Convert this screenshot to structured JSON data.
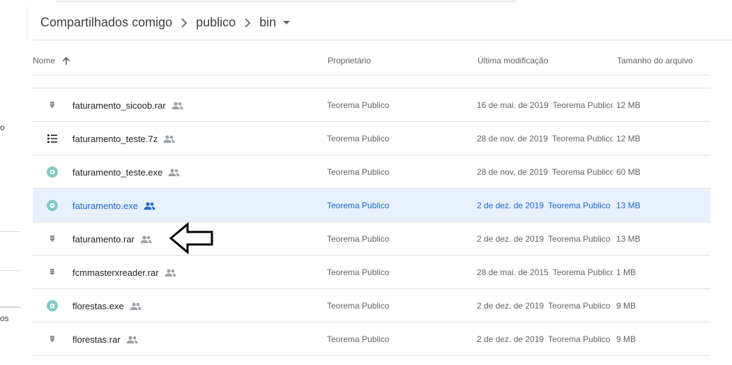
{
  "sidebar": {
    "frag_1": "o",
    "frag_2": "os"
  },
  "breadcrumb": {
    "items": [
      "Compartilhados comigo",
      "publico",
      "bin"
    ]
  },
  "toolbar": {
    "icons": [
      "link-icon",
      "add-person-icon",
      "preview-eye-icon",
      "trash-icon",
      "more-vert-icon",
      "grid-view-icon"
    ]
  },
  "columns": {
    "name": "Nome",
    "owner": "Proprietário",
    "modified": "Última modificação",
    "size": "Tamanho do arquivo"
  },
  "files": [
    {
      "name": "faturamento_sicoob.rar",
      "icon": "archive-icon",
      "owner": "Teorema Publico",
      "date": "16 de mai. de 2019",
      "by": "Teorema Publico",
      "size": "12 MB",
      "selected": false
    },
    {
      "name": "faturamento_teste.7z",
      "icon": "list-file-icon",
      "owner": "Teorema Publico",
      "date": "28 de nov. de 2019",
      "by": "Teorema Publico",
      "size": "12 MB",
      "selected": false
    },
    {
      "name": "faturamento_teste.exe",
      "icon": "exe-file-icon",
      "owner": "Teorema Publico",
      "date": "28 de nov. de 2019",
      "by": "Teorema Publico",
      "size": "60 MB",
      "selected": false
    },
    {
      "name": "faturamento.exe",
      "icon": "exe-file-icon",
      "owner": "Teorema Publico",
      "date": "2 de dez. de 2019",
      "by": "Teorema Publico",
      "size": "13 MB",
      "selected": true
    },
    {
      "name": "faturamento.rar",
      "icon": "archive-icon",
      "owner": "Teorema Publico",
      "date": "2 de dez. de 2019",
      "by": "Teorema Publico",
      "size": "13 MB",
      "selected": false
    },
    {
      "name": "fcmmasterxreader.rar",
      "icon": "archive-icon",
      "owner": "Teorema Publico",
      "date": "28 de mai. de 2015",
      "by": "Teorema Publico",
      "size": "1 MB",
      "selected": false
    },
    {
      "name": "florestas.exe",
      "icon": "exe-file-icon",
      "owner": "Teorema Publico",
      "date": "2 de dez. de 2019",
      "by": "Teorema Publico",
      "size": "9 MB",
      "selected": false
    },
    {
      "name": "florestas.rar",
      "icon": "archive-icon",
      "owner": "Teorema Publico",
      "date": "2 de dez. de 2019",
      "by": "Teorema Publico",
      "size": "9 MB",
      "selected": false
    }
  ],
  "colors": {
    "selected_bg": "#e8f0fe",
    "selected_text": "#1967d2",
    "exe_icon": "#80cbc4",
    "divider": "#e0e0e0"
  }
}
